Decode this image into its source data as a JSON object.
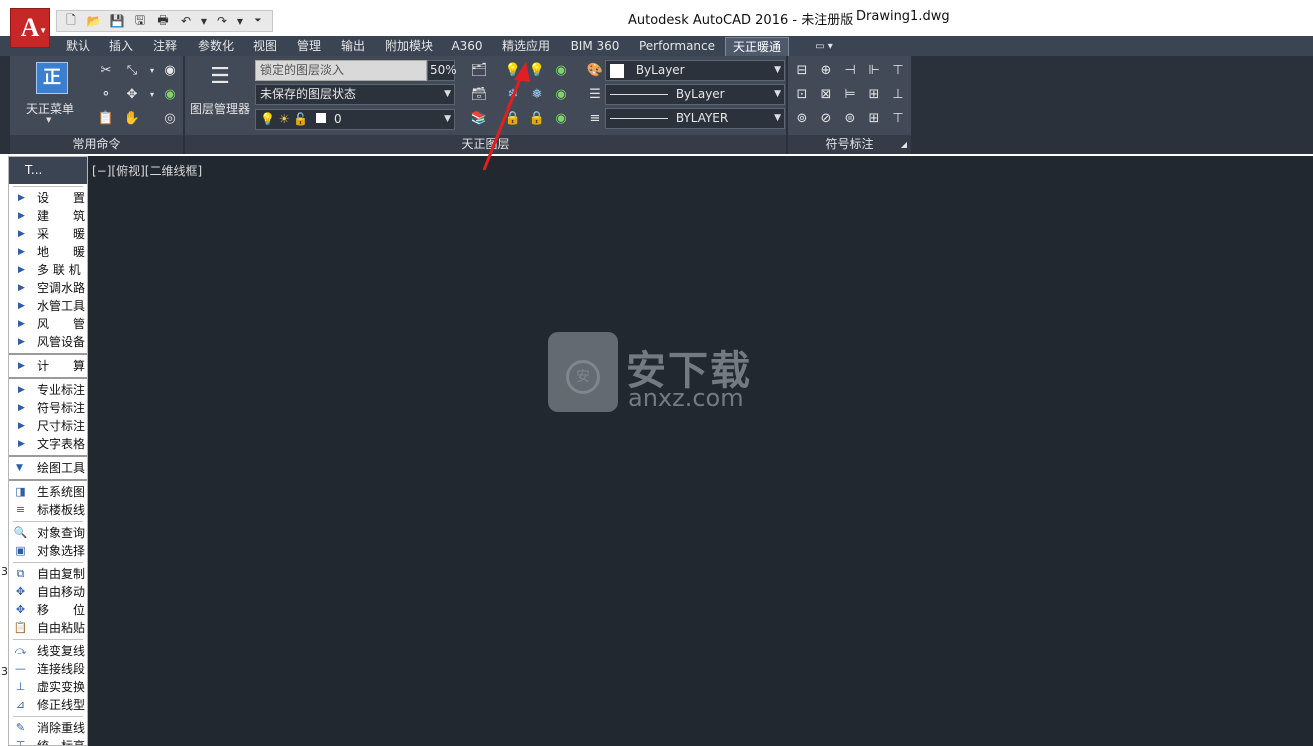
{
  "window": {
    "title": "Autodesk AutoCAD 2016 - 未注册版",
    "file": "Drawing1.dwg",
    "app_button": "A"
  },
  "tabs": [
    "默认",
    "插入",
    "注释",
    "参数化",
    "视图",
    "管理",
    "输出",
    "附加模块",
    "A360",
    "精选应用",
    "BIM 360",
    "Performance",
    "天正暖通"
  ],
  "active_tab": "天正暖通",
  "ribbon": {
    "tz_menu_label": "天正菜单",
    "common_panel_title": "常用命令",
    "layer_manager_label": "图层管理器",
    "layer_fade_label": "锁定的图层淡入",
    "layer_fade_value": "50%",
    "layer_state": "未保存的图层状态",
    "current_layer": "0",
    "layer_panel_title": "天正图层",
    "color_value": "ByLayer",
    "linetype_value": "ByLayer",
    "lineweight_value": "BYLAYER",
    "symbol_panel_title": "符号标注"
  },
  "palette": {
    "header": "T...",
    "items_a": [
      "设　　置",
      "建　　筑",
      "采　　暖",
      "地　　暖",
      "多 联 机",
      "空调水路",
      "水管工具",
      "风　　管",
      "风管设备"
    ],
    "items_b": [
      "计　　算"
    ],
    "items_c": [
      "专业标注",
      "符号标注",
      "尺寸标注",
      "文字表格"
    ],
    "drawing_tools": "绘图工具",
    "items_d": [
      "生系统图",
      "标楼板线"
    ],
    "items_e": [
      "对象查询",
      "对象选择"
    ],
    "items_f": [
      "自由复制",
      "自由移动",
      "移　　位",
      "自由粘贴"
    ],
    "items_g": [
      "线变复线",
      "连接线段",
      "虚实变换",
      "修正线型"
    ],
    "items_h": [
      "消除重线",
      "统一标高"
    ],
    "side_num": "3"
  },
  "viewport": {
    "label": "[−][俯视][二维线框]"
  },
  "watermark": {
    "cn": "安下载",
    "en": "anxz.com",
    "shield": "安"
  },
  "colors": {
    "ribbon_bg": "#424a57",
    "canvas_bg": "#212830",
    "tabbar_bg": "#3b4453",
    "app_red": "#c62828",
    "arrow_red": "#e02020"
  }
}
